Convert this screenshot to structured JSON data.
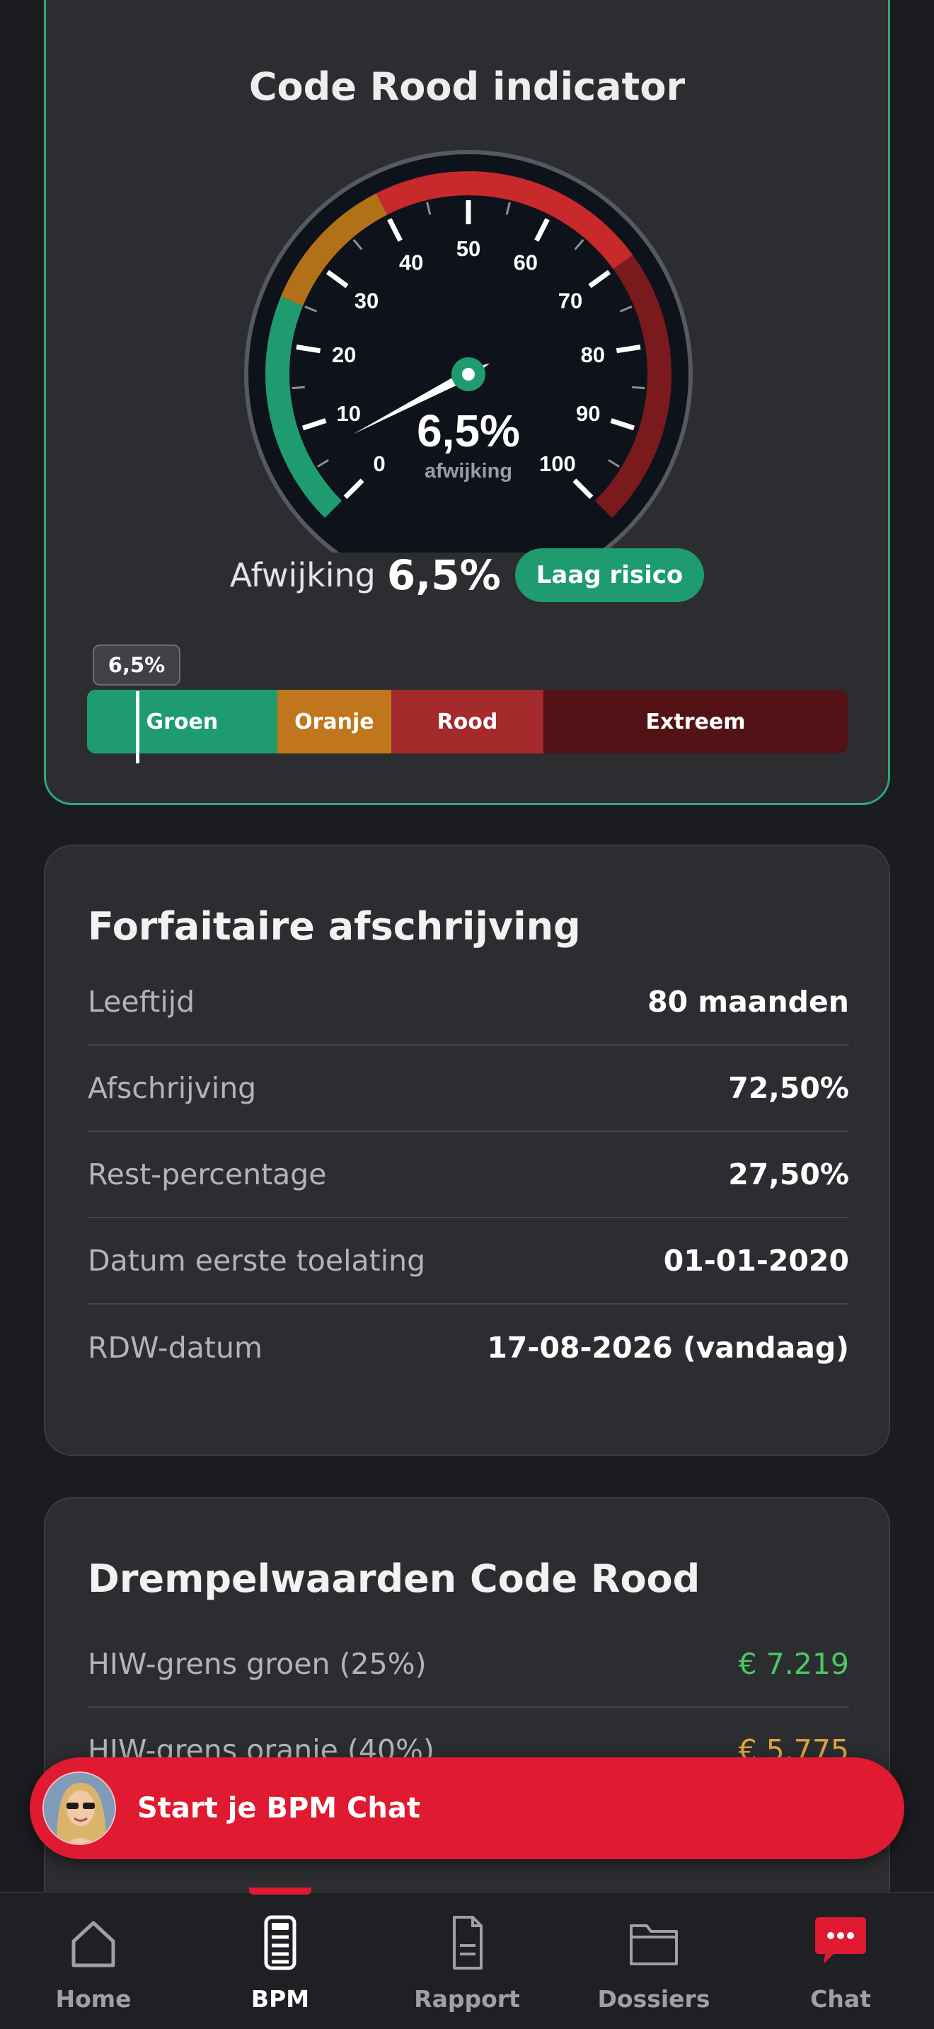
{
  "gauge": {
    "title": "Code Rood indicator",
    "center_value": "6,5%",
    "center_caption": "afwijking",
    "value": 6.5,
    "min": 0,
    "max": 100,
    "tick_labels": [
      "0",
      "10",
      "20",
      "30",
      "40",
      "50",
      "60",
      "70",
      "80",
      "90",
      "100"
    ],
    "zones": [
      {
        "from": 0,
        "to": 25,
        "color": "#1e9c6f"
      },
      {
        "from": 25,
        "to": 40,
        "color": "#b27019"
      },
      {
        "from": 40,
        "to": 70,
        "color": "#c8292b"
      },
      {
        "from": 70,
        "to": 100,
        "color": "#7a1a1d"
      }
    ],
    "deviation_label": "Afwijking",
    "deviation_value": "6,5%",
    "risk_badge": "Laag risico",
    "scale_tag": "6,5%",
    "scale_segments": [
      {
        "label": "Groen",
        "color": "#1e9c6f",
        "weight": 25
      },
      {
        "label": "Oranje",
        "color": "#c0761d",
        "weight": 15
      },
      {
        "label": "Rood",
        "color": "#a52a2c",
        "weight": 20
      },
      {
        "label": "Extreem",
        "color": "#531215",
        "weight": 40
      }
    ]
  },
  "afschrijving": {
    "title": "Forfaitaire afschrijving",
    "rows": [
      {
        "label": "Leeftijd",
        "value": "80 maanden"
      },
      {
        "label": "Afschrijving",
        "value": "72,50%"
      },
      {
        "label": "Rest-percentage",
        "value": "27,50%"
      },
      {
        "label": "Datum eerste toelating",
        "value": "01-01-2020"
      },
      {
        "label": "RDW-datum",
        "value": "17-08-2026 (vandaag)"
      }
    ]
  },
  "drempel": {
    "title": "Drempelwaarden Code Rood",
    "rows": [
      {
        "label": "HIW-grens groen (25%)",
        "value": "€ 7.219",
        "color": "#4cc764"
      },
      {
        "label": "HIW-grens oranje (40%)",
        "value": "€ 5.775",
        "color": "#e0a43a"
      }
    ]
  },
  "chat": {
    "label": "Start je BPM Chat"
  },
  "nav": {
    "items": [
      {
        "label": "Home",
        "icon": "home-icon"
      },
      {
        "label": "BPM",
        "icon": "calculator-icon"
      },
      {
        "label": "Rapport",
        "icon": "document-icon"
      },
      {
        "label": "Dossiers",
        "icon": "folder-icon"
      },
      {
        "label": "Chat",
        "icon": "chat-icon"
      }
    ],
    "active": "BPM"
  }
}
